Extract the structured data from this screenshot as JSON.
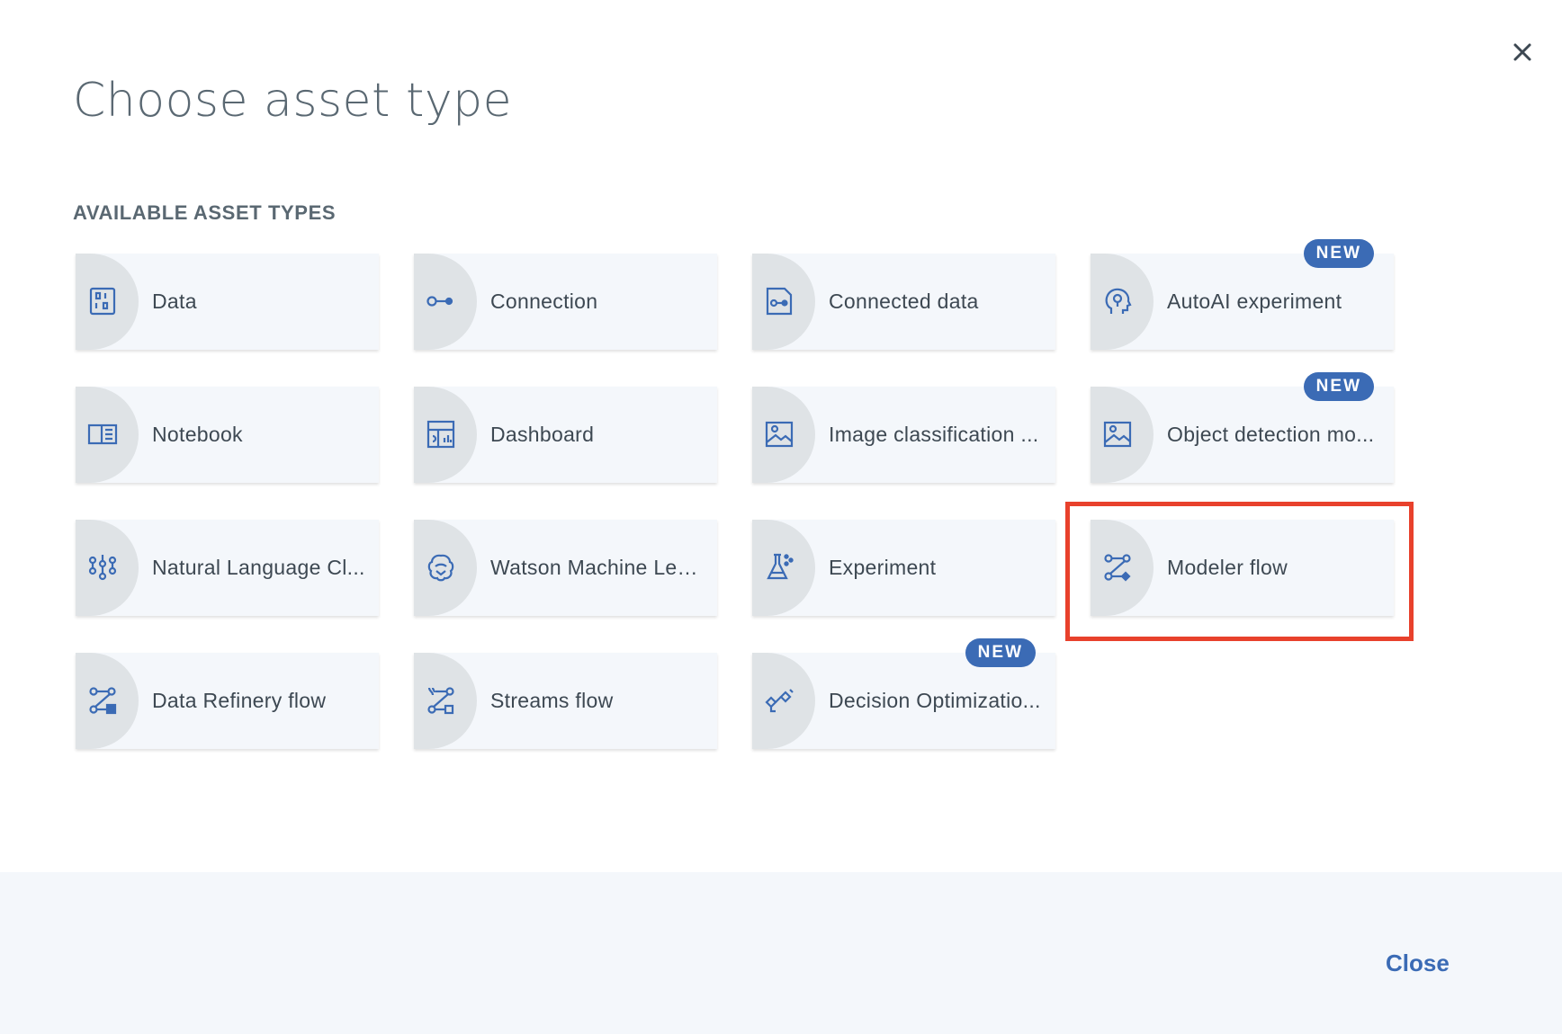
{
  "dialog": {
    "title": "Choose asset type",
    "section_label": "AVAILABLE ASSET TYPES",
    "close_icon": "close-icon",
    "footer_close_label": "Close"
  },
  "colors": {
    "accent": "#3b6bb5",
    "tile_bg": "#f4f7fb",
    "highlight": "#e8412c"
  },
  "badge_label": "NEW",
  "tiles": [
    {
      "label": "Data",
      "icon": "data-icon",
      "new": false
    },
    {
      "label": "Connection",
      "icon": "connection-icon",
      "new": false
    },
    {
      "label": "Connected data",
      "icon": "connected-data-icon",
      "new": false
    },
    {
      "label": "AutoAI experiment",
      "icon": "autoai-icon",
      "new": true
    },
    {
      "label": "Notebook",
      "icon": "notebook-icon",
      "new": false
    },
    {
      "label": "Dashboard",
      "icon": "dashboard-icon",
      "new": false
    },
    {
      "label": "Image classification ...",
      "icon": "image-classification-icon",
      "new": false
    },
    {
      "label": "Object detection mo...",
      "icon": "object-detection-icon",
      "new": true
    },
    {
      "label": "Natural Language Cl...",
      "icon": "natural-language-icon",
      "new": false
    },
    {
      "label": "Watson Machine Lea...",
      "icon": "watson-ml-icon",
      "new": false
    },
    {
      "label": "Experiment",
      "icon": "experiment-icon",
      "new": false
    },
    {
      "label": "Modeler flow",
      "icon": "modeler-flow-icon",
      "new": false,
      "highlighted": true
    },
    {
      "label": "Data Refinery flow",
      "icon": "data-refinery-icon",
      "new": false
    },
    {
      "label": "Streams flow",
      "icon": "streams-flow-icon",
      "new": false
    },
    {
      "label": "Decision Optimizatio...",
      "icon": "decision-optimization-icon",
      "new": true
    }
  ]
}
